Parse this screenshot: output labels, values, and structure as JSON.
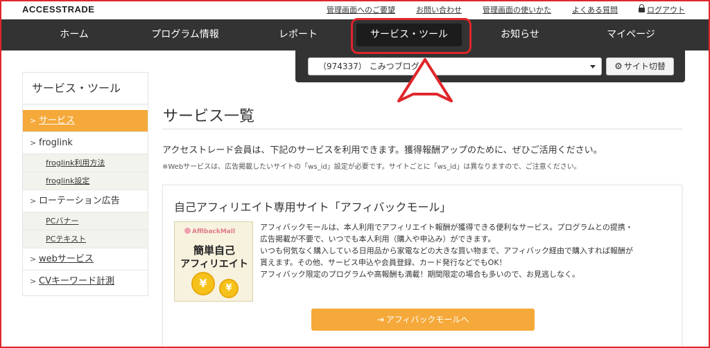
{
  "header": {
    "logo": "ACCESSTRADE",
    "links": [
      "管理画面へのご要望",
      "お問い合わせ",
      "管理画面の使いかた",
      "よくある質問",
      "ログアウト"
    ]
  },
  "nav": {
    "items": [
      "ホーム",
      "プログラム情報",
      "レポート",
      "サービス・ツール",
      "お知らせ",
      "マイページ"
    ],
    "active_index": 3
  },
  "site_switcher": {
    "selected": "（974337） こみつブログ",
    "button_label": "サイト切替",
    "button_icon": "gear-icon"
  },
  "sidebar": {
    "title": "サービス・ツール",
    "items": [
      {
        "label": "サービス",
        "active": true
      },
      {
        "label": "froglink",
        "subs": [
          "froglink利用方法",
          "froglink設定"
        ]
      },
      {
        "label": "ローテーション広告",
        "subs": [
          "PCバナー",
          "PCテキスト"
        ]
      },
      {
        "label": "webサービス",
        "link": true
      },
      {
        "label": "CVキーワード計測",
        "link": true
      }
    ]
  },
  "main": {
    "title": "サービス一覧",
    "intro": "アクセストレード会員は、下記のサービスを利用できます。獲得報酬アップのために、ぜひご活用ください。",
    "note": "※Webサービスは、広告掲載したいサイトの「ws_id」設定が必要です。サイトごとに「ws_id」は異なりますので、ご注意ください。",
    "card": {
      "title": "自己アフィリエイト専用サイト「アフィバックモール」",
      "image": {
        "brand": "AffibackMall",
        "line1": "簡単自己",
        "line2": "アフィリエイト",
        "coin": "¥"
      },
      "desc": [
        "アフィバックモールは、本人利用でアフィリエイト報酬が獲得できる便利なサービス。プログラムとの提携・",
        "広告掲載が不要で、いつでも本人利用（購入や申込み）ができます。",
        "いつも何気なく購入している日用品から家電などの大きな買い物まで、アフィバック経由で購入すれば報酬が",
        "貰えます。その他、サービス申込や会員登録、カード発行などでもOK！",
        "アフィバック限定のプログラムや高報酬も満載！期間限定の場合も多いので、お見逃しなく。"
      ],
      "button_label": "アフィバックモールへ"
    }
  },
  "colors": {
    "accent": "#f5a93a",
    "nav_bg": "#333333",
    "annotation": "#e0262b"
  }
}
